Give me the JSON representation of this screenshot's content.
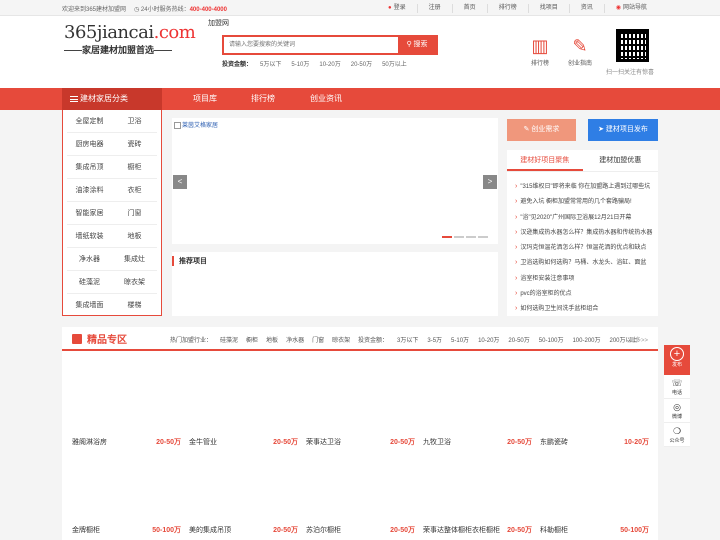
{
  "topbar": {
    "welcome": "欢迎来到365建材加盟网",
    "hotline_label": "24小时服务热线：",
    "hotline_number": "400-400-4000",
    "nav": [
      "登录",
      "注册",
      "首页",
      "排行榜",
      "找项目",
      "资讯",
      "网站导航"
    ]
  },
  "logo": {
    "domain_main": "365jiancai",
    "domain_suffix": ".com",
    "badge": "加盟网",
    "slogan": "——家居建材加盟首选——"
  },
  "search": {
    "placeholder": "请输入您要搜索的关键词",
    "button": "搜索"
  },
  "invest_filter": {
    "label": "投资金额：",
    "options": [
      "5万以下",
      "5-10万",
      "10-20万",
      "20-50万",
      "50万以上"
    ]
  },
  "header_icons": [
    {
      "label": "排行榜",
      "icon": "ranking-icon"
    },
    {
      "label": "创业指南",
      "icon": "guide-icon"
    }
  ],
  "qr_caption": "扫一扫关注有惊喜",
  "main_nav": {
    "category_button": "建材家居分类",
    "links": [
      "项目库",
      "排行榜",
      "创业资讯"
    ]
  },
  "categories": [
    [
      "全屋定制",
      "卫浴"
    ],
    [
      "厨房电器",
      "瓷砖"
    ],
    [
      "集成吊顶",
      "橱柜"
    ],
    [
      "油漆涂料",
      "衣柜"
    ],
    [
      "智能家居",
      "门窗"
    ],
    [
      "墙纸软装",
      "地板"
    ],
    [
      "净水器",
      "集成灶"
    ],
    [
      "硅藻泥",
      "晾衣架"
    ],
    [
      "集成墙面",
      "楼梯"
    ]
  ],
  "banner": {
    "image_alt": "莱茵艾格家居",
    "prev": "<",
    "next": ">"
  },
  "recommend_title": "推荐项目",
  "actions": {
    "request": "创业需求",
    "publish": "建材项目发布"
  },
  "news_tabs": [
    "建材好项目聚焦",
    "建材加盟优惠"
  ],
  "news": [
    "\"315维权日\"即将来临 你在加盟路上遇到过哪些坑",
    "避免入坑 橱柜加盟常常用的几个套路骗局!",
    "\"浴\"见2020\"广州国际卫浴展12月21日开幕",
    "汉逊集成热水器怎么样？集成热水器和传统热水器",
    "汉玛克恒温花洒怎么样？恒温花洒的优点和缺点",
    "卫浴选购如何选购？马桶、水龙头、浴缸、面盆",
    "浴室柜安装注意事项",
    "pvc的浴室柜的优点",
    "如何选购卫生间洗手盆柜组合"
  ],
  "premium": {
    "title": "精品专区",
    "hot_label": "热门加盟行业：",
    "hot_industries": [
      "硅藻泥",
      "橱柜",
      "地板",
      "净水器",
      "门窗",
      "晾衣架"
    ],
    "invest_label": "投资金额：",
    "invest_options": [
      "3万以下",
      "3-5万",
      "5-10万",
      "10-20万",
      "20-50万",
      "50-100万",
      "100-200万",
      "200万以上"
    ],
    "more": "更多>>",
    "cards": [
      {
        "name": "雅阁淋浴房",
        "price": "20-50万"
      },
      {
        "name": "金牛管业",
        "price": "20-50万"
      },
      {
        "name": "荣事达卫浴",
        "price": "20-50万"
      },
      {
        "name": "九牧卫浴",
        "price": "20-50万"
      },
      {
        "name": "东鹏瓷砖",
        "price": "10-20万"
      },
      {
        "name": "金牌橱柜",
        "price": "50-100万"
      },
      {
        "name": "美的集成吊顶",
        "price": "20-50万"
      },
      {
        "name": "苏泊尔橱柜",
        "price": "20-50万"
      },
      {
        "name": "荣事达整体橱柜衣柜橱柜",
        "price": "20-50万"
      },
      {
        "name": "科勒橱柜",
        "price": "50-100万"
      }
    ]
  },
  "float_bar": {
    "publish": "发布",
    "items": [
      {
        "label": "电话",
        "icon": "headset-icon"
      },
      {
        "label": "微博",
        "icon": "weibo-icon"
      },
      {
        "label": "公众号",
        "icon": "wechat-icon"
      }
    ]
  }
}
